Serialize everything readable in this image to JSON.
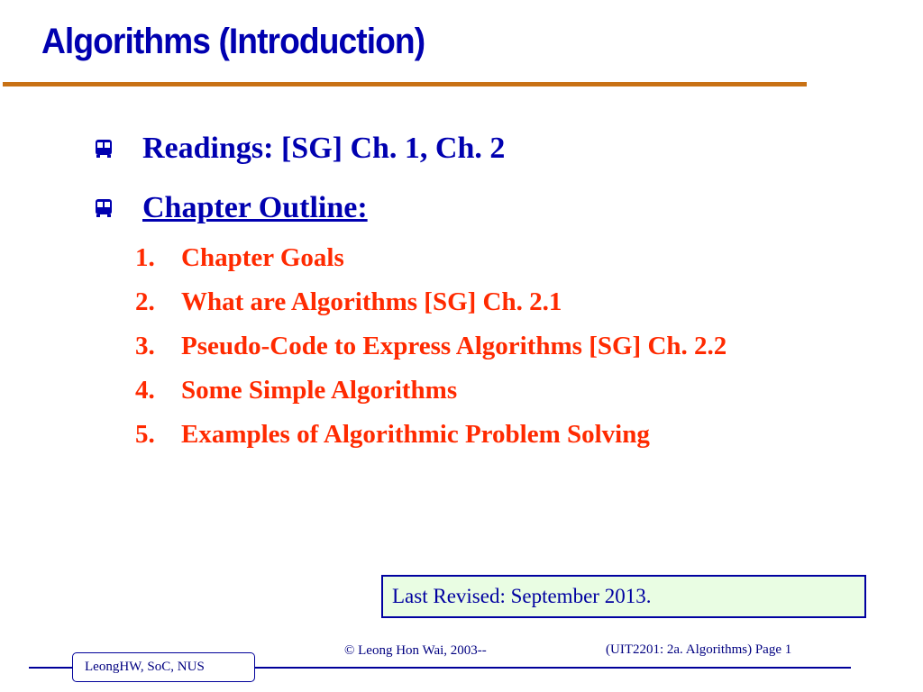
{
  "slide": {
    "title": "Algorithms (Introduction)",
    "accent_color": "#c87114",
    "bullets": [
      {
        "icon": "bus-icon",
        "text": "Readings:  [SG] Ch. 1, Ch. 2"
      },
      {
        "icon": "bus-icon",
        "text": "Chapter Outline:"
      }
    ],
    "outline": [
      {
        "num": "1.",
        "text": "Chapter Goals"
      },
      {
        "num": "2.",
        "text": "What are Algorithms [SG] Ch. 2.1"
      },
      {
        "num": "3.",
        "text": "Pseudo-Code to Express Algorithms [SG] Ch. 2.2"
      },
      {
        "num": "4.",
        "text": "Some Simple Algorithms"
      },
      {
        "num": "5.",
        "text": "Examples of Algorithmic Problem Solving"
      }
    ],
    "last_revised": "Last Revised: September 2013."
  },
  "footer": {
    "author_box": "LeongHW, SoC, NUS",
    "copyright": "© Leong Hon Wai, 2003--",
    "page_info": "(UIT2201: 2a. Algorithms) Page 1"
  }
}
